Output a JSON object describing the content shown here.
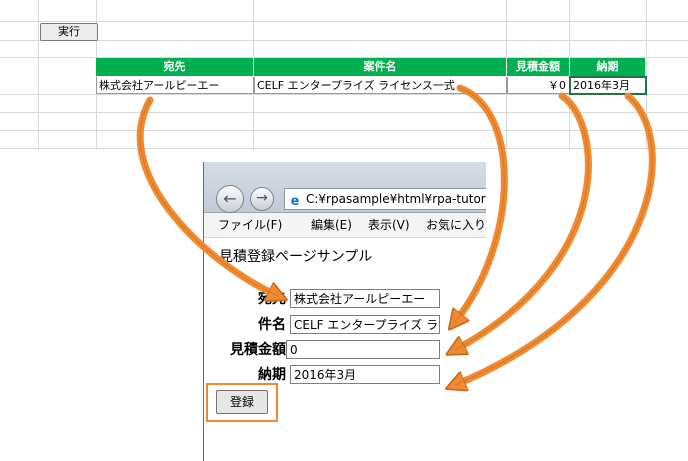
{
  "spreadsheet": {
    "run_button": "実行",
    "headers": [
      "宛先",
      "案件名",
      "見積金額",
      "納期"
    ],
    "row": {
      "address": "株式会社アールピーエー",
      "project": "CELF エンタープライズ  ライセンス一式",
      "amount": "￥0",
      "deadline": "2016年3月"
    },
    "header_color": "#00b050"
  },
  "browser": {
    "address_bar": "C:¥rpasample¥html¥rpa-tutori",
    "menu": [
      "ファイル(F)",
      "編集(E)",
      "表示(V)",
      "お気に入り"
    ],
    "page_title": "見積登録ページサンプル",
    "form": {
      "fields": [
        {
          "label": "宛先",
          "value": "株式会社アールピーエー"
        },
        {
          "label": "件名",
          "value": "CELF エンタープライズ  ライ"
        },
        {
          "label": "見積金額",
          "value": "0"
        },
        {
          "label": "納期",
          "value": "2016年3月"
        }
      ],
      "submit_label": "登録"
    }
  },
  "colors": {
    "arrow": "#f08a30",
    "arrow_stroke": "#c8691c"
  }
}
